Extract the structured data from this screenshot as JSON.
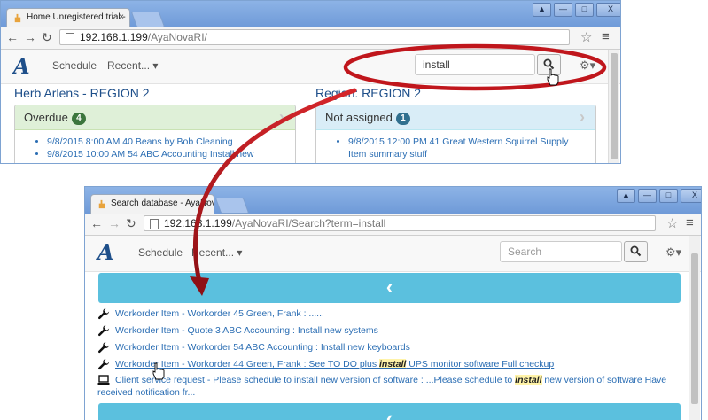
{
  "window1": {
    "tab_title": "Home Unregistered trial -",
    "tab_close": "×",
    "window_controls": [
      "▲",
      "—",
      "□",
      "X"
    ],
    "url_host": "192.168.1.199",
    "url_path": "/AyaNovaRI/",
    "nav": {
      "brand": "A",
      "schedule": "Schedule",
      "recent": "Recent... ▾"
    },
    "search": {
      "value": "install"
    },
    "left_section_title": "Herb Arlens - REGION 2",
    "right_section_title": "Region: REGION 2",
    "overdue_panel": {
      "label": "Overdue",
      "count": "4",
      "items": [
        "9/8/2015 8:00 AM 40 Beans by Bob Cleaning",
        "9/8/2015 10:00 AM 54 ABC Accounting Install new"
      ]
    },
    "not_assigned_panel": {
      "label": "Not assigned",
      "count": "1",
      "items": [
        "9/8/2015 12:00 PM 41 Great Western Squirrel Supply",
        "Item summary stuff"
      ]
    }
  },
  "window2": {
    "tab_title": "Search database - AyaNov",
    "tab_close": "×",
    "window_controls": [
      "▲",
      "—",
      "□",
      "X"
    ],
    "url_host": "192.168.1.199",
    "url_path": "/AyaNovaRI/Search?term=install",
    "nav": {
      "brand": "A",
      "schedule": "Schedule",
      "recent": "Recent... ▾"
    },
    "search": {
      "placeholder": "Search"
    },
    "back_banner": "‹",
    "results": [
      {
        "icon": "wrench-icon",
        "text": "Workorder Item - Workorder 45 Green, Frank : ......"
      },
      {
        "icon": "wrench-icon",
        "text": "Workorder Item - Quote 3 ABC Accounting : Install new systems"
      },
      {
        "icon": "wrench-icon",
        "text": "Workorder Item - Workorder 54 ABC Accounting : Install new keyboards"
      },
      {
        "icon": "wrench-icon",
        "pre": "Workorder Item - Workorder 44 Green, Frank : See TO DO plus ",
        "highlight": "install",
        "post": " UPS monitor software Full checkup"
      },
      {
        "icon": "laptop-icon",
        "pre": "Client service request - Please schedule to install new version of software : ...Please schedule to ",
        "highlight": "install",
        "post": " new version of software Have",
        "line2": "received notification fr..."
      }
    ]
  },
  "colors": {
    "brand": "#1e4f8a",
    "link": "#2a6db3",
    "overdue_header": "#dff0d8",
    "overdue_badge": "#3c763d",
    "not_assigned_header": "#d9edf7",
    "not_assigned_badge": "#31708f",
    "banner": "#5bc0de",
    "annotation": "#c0161c"
  }
}
